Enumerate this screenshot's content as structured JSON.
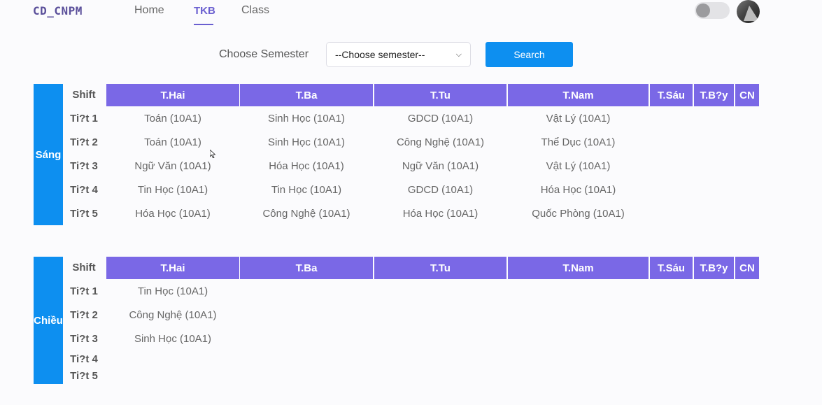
{
  "brand": "CD_CNPM",
  "nav": {
    "home": "Home",
    "tkb": "TKB",
    "class": "Class"
  },
  "toggle_state": "off",
  "semester": {
    "label": "Choose Semester",
    "selected": "--Choose semester--",
    "search": "Search"
  },
  "headers": {
    "shift": "Shift",
    "days": [
      "T.Hai",
      "T.Ba",
      "T.Tu",
      "T.Nam",
      "T.Sáu",
      "T.B?y",
      "CN"
    ]
  },
  "morning": {
    "label": "Sáng",
    "periods": [
      "Ti?t 1",
      "Ti?t 2",
      "Ti?t 3",
      "Ti?t 4",
      "Ti?t 5"
    ],
    "rows": [
      [
        "Toán (10A1)",
        "Sinh Học (10A1)",
        "GDCD (10A1)",
        "Vật Lý (10A1)"
      ],
      [
        "Toán (10A1)",
        "Sinh Học (10A1)",
        "Công Nghệ (10A1)",
        "Thể Dục (10A1)"
      ],
      [
        "Ngữ Văn (10A1)",
        "Hóa Học (10A1)",
        "Ngữ Văn (10A1)",
        "Vật Lý (10A1)"
      ],
      [
        "Tin Học (10A1)",
        "Tin Học (10A1)",
        "GDCD (10A1)",
        "Hóa Học (10A1)"
      ],
      [
        "Hóa Học (10A1)",
        "Công Nghệ (10A1)",
        "Hóa Học (10A1)",
        "Quốc Phòng (10A1)"
      ]
    ]
  },
  "afternoon": {
    "label": "Chiều",
    "periods": [
      "Ti?t 1",
      "Ti?t 2",
      "Ti?t 3",
      "Ti?t 4",
      "Ti?t 5"
    ],
    "rows": [
      [
        "Tin Học (10A1)"
      ],
      [
        "Công Nghệ (10A1)"
      ],
      [
        "Sinh Học (10A1)"
      ]
    ]
  }
}
